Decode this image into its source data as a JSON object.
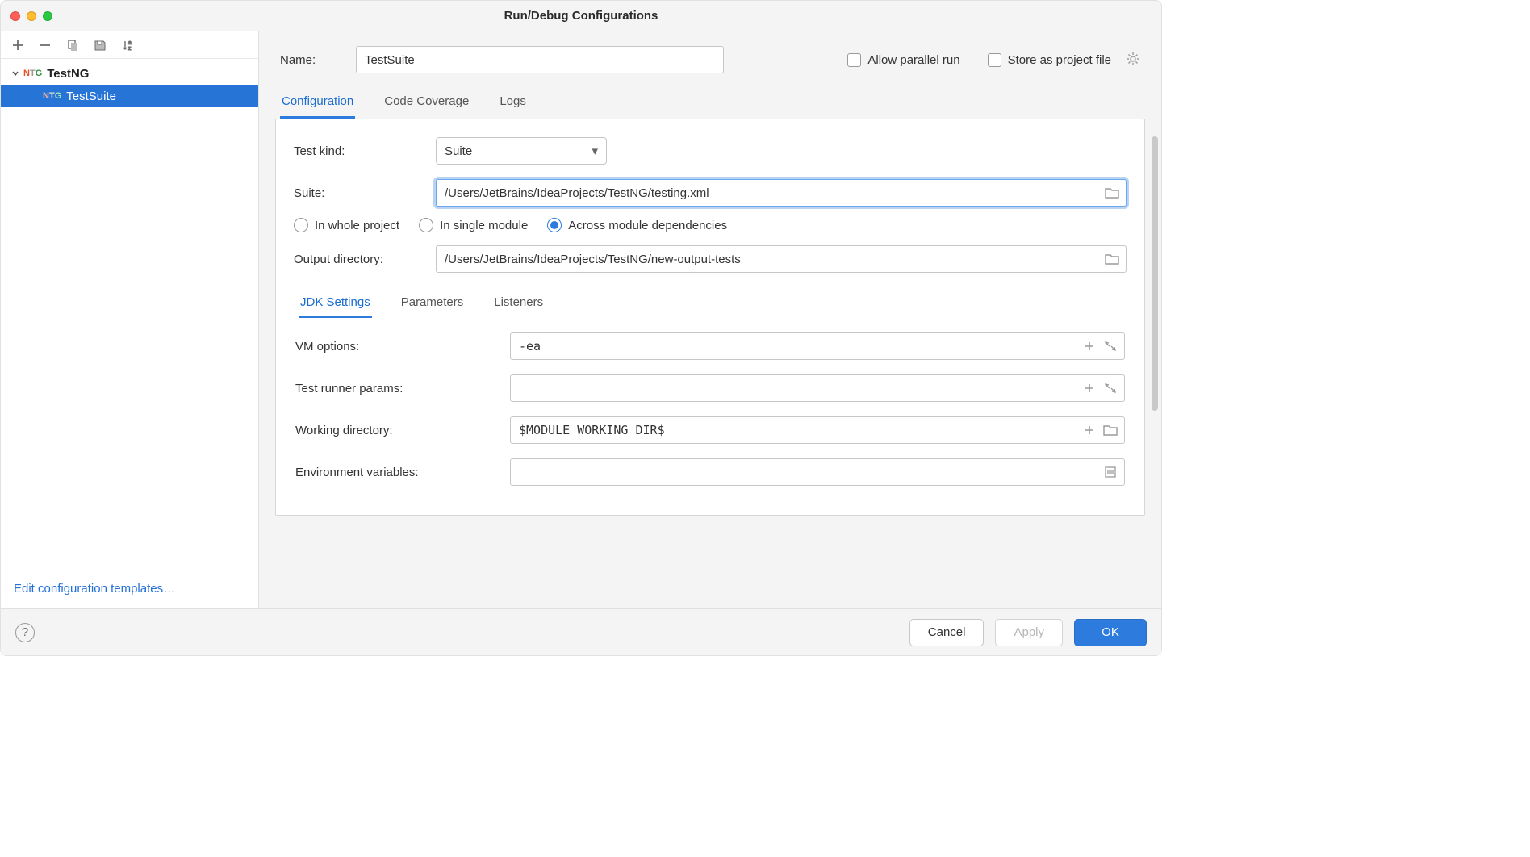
{
  "window": {
    "title": "Run/Debug Configurations"
  },
  "sidebar": {
    "group_label": "TestNG",
    "item_label": "TestSuite",
    "edit_templates_label": "Edit configuration templates…"
  },
  "toprow": {
    "name_label": "Name:",
    "name_value": "TestSuite",
    "allow_parallel_label": "Allow parallel run",
    "store_label": "Store as project file"
  },
  "tabs": {
    "configuration": "Configuration",
    "code_coverage": "Code Coverage",
    "logs": "Logs"
  },
  "config": {
    "test_kind_label": "Test kind:",
    "test_kind_value": "Suite",
    "suite_label": "Suite:",
    "suite_value": "/Users/JetBrains/IdeaProjects/TestNG/testing.xml",
    "scope": {
      "whole_project": "In whole project",
      "single_module": "In single module",
      "across_deps": "Across module dependencies"
    },
    "output_dir_label": "Output directory:",
    "output_dir_value": "/Users/JetBrains/IdeaProjects/TestNG/new-output-tests"
  },
  "subtabs": {
    "jdk": "JDK Settings",
    "parameters": "Parameters",
    "listeners": "Listeners"
  },
  "jdk": {
    "vm_label": "VM options:",
    "vm_value": "-ea",
    "runner_label": "Test runner params:",
    "runner_value": "",
    "wd_label": "Working directory:",
    "wd_value": "$MODULE_WORKING_DIR$",
    "env_label": "Environment variables:",
    "env_value": ""
  },
  "footer": {
    "cancel": "Cancel",
    "apply": "Apply",
    "ok": "OK"
  }
}
